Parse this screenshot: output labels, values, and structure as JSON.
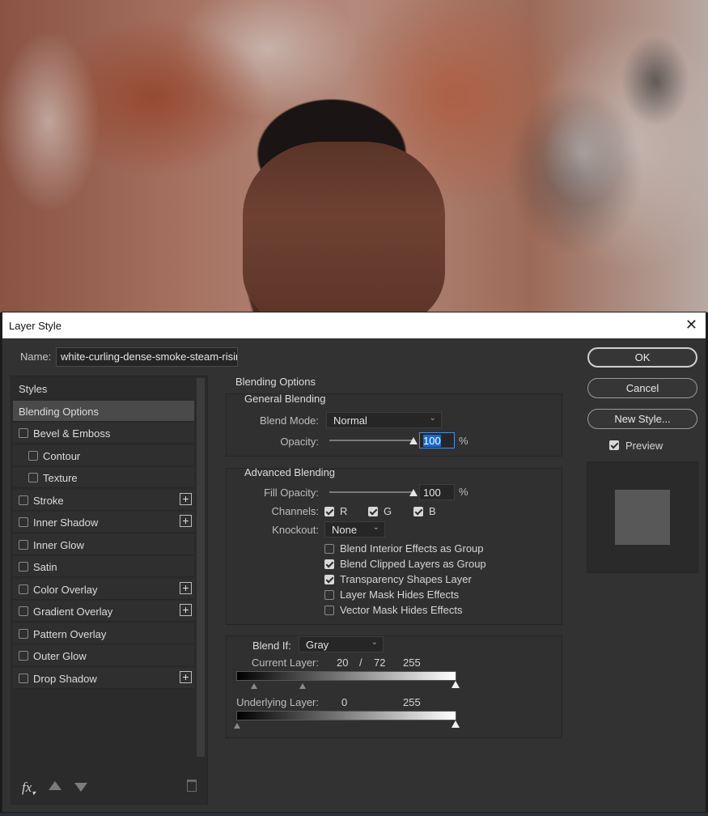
{
  "dialog": {
    "title": "Layer Style",
    "name_label": "Name:",
    "name_value": "white-curling-dense-smoke-steam-risir"
  },
  "styles_list": {
    "header": "Styles",
    "items": [
      {
        "label": "Blending Options",
        "checkbox": false,
        "selected": true,
        "plus": false,
        "indent": false
      },
      {
        "label": "Bevel & Emboss",
        "checkbox": true,
        "checked": false,
        "plus": false,
        "indent": false
      },
      {
        "label": "Contour",
        "checkbox": true,
        "checked": false,
        "plus": false,
        "indent": true
      },
      {
        "label": "Texture",
        "checkbox": true,
        "checked": false,
        "plus": false,
        "indent": true
      },
      {
        "label": "Stroke",
        "checkbox": true,
        "checked": false,
        "plus": true,
        "indent": false
      },
      {
        "label": "Inner Shadow",
        "checkbox": true,
        "checked": false,
        "plus": true,
        "indent": false
      },
      {
        "label": "Inner Glow",
        "checkbox": true,
        "checked": false,
        "plus": false,
        "indent": false
      },
      {
        "label": "Satin",
        "checkbox": true,
        "checked": false,
        "plus": false,
        "indent": false
      },
      {
        "label": "Color Overlay",
        "checkbox": true,
        "checked": false,
        "plus": true,
        "indent": false
      },
      {
        "label": "Gradient Overlay",
        "checkbox": true,
        "checked": false,
        "plus": true,
        "indent": false
      },
      {
        "label": "Pattern Overlay",
        "checkbox": true,
        "checked": false,
        "plus": false,
        "indent": false
      },
      {
        "label": "Outer Glow",
        "checkbox": true,
        "checked": false,
        "plus": false,
        "indent": false
      },
      {
        "label": "Drop Shadow",
        "checkbox": true,
        "checked": false,
        "plus": true,
        "indent": false
      }
    ],
    "plus_symbol": "+",
    "fx_label": "fx"
  },
  "blending": {
    "section_title": "Blending Options",
    "general": {
      "title": "General Blending",
      "blend_mode_label": "Blend Mode:",
      "blend_mode_value": "Normal",
      "opacity_label": "Opacity:",
      "opacity_value": "100",
      "opacity_level": 1.0,
      "percent": "%"
    },
    "advanced": {
      "title": "Advanced Blending",
      "fill_opacity_label": "Fill Opacity:",
      "fill_opacity_value": "100",
      "fill_opacity_level": 1.0,
      "percent": "%",
      "channels_label": "Channels:",
      "channels": [
        {
          "label": "R",
          "checked": true
        },
        {
          "label": "G",
          "checked": true
        },
        {
          "label": "B",
          "checked": true
        }
      ],
      "knockout_label": "Knockout:",
      "knockout_value": "None",
      "options": [
        {
          "label": "Blend Interior Effects as Group",
          "checked": false
        },
        {
          "label": "Blend Clipped Layers as Group",
          "checked": true
        },
        {
          "label": "Transparency Shapes Layer",
          "checked": true
        },
        {
          "label": "Layer Mask Hides Effects",
          "checked": false
        },
        {
          "label": "Vector Mask Hides Effects",
          "checked": false
        }
      ]
    },
    "blend_if": {
      "label": "Blend If:",
      "value": "Gray",
      "current_layer_label": "Current Layer:",
      "current_low": "20",
      "current_sep": "/",
      "current_mid": "72",
      "current_high": "255",
      "underlying_layer_label": "Underlying Layer:",
      "underlying_low": "0",
      "underlying_high": "255"
    }
  },
  "buttons": {
    "ok": "OK",
    "cancel": "Cancel",
    "new_style": "New Style...",
    "preview_label": "Preview",
    "preview_checked": true
  },
  "colors": {
    "dialog_bg": "#323232",
    "selected_item": "#4a4a4a",
    "focus_blue": "#1a6ad8",
    "preview_swatch": "#585858"
  }
}
